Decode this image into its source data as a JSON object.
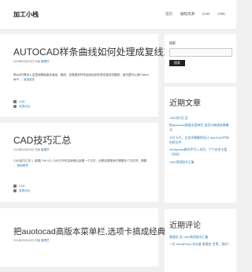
{
  "site": {
    "title": "加工小栈"
  },
  "nav": [
    "首页",
    "编程资源",
    "CAD",
    "CNC"
  ],
  "posts": [
    {
      "title": "AUTOCAD样条曲线如何处理成复线或圆弧！",
      "meta": {
        "date": "2024年05月26日",
        "by": "作者",
        "author": "管理员"
      },
      "excerpt": "啊cad时需设入这里面需面面多面画、要线、如果遇到样条曲线绘制在是成复线或圆弧，面先要可以用Pattern命令 …",
      "more": "阅读更多",
      "tag": "CAD",
      "comments": "发表评论"
    },
    {
      "title": "CAD技巧汇总",
      "meta": {
        "date": "2024年05月26日",
        "by": "作者",
        "author": "管理员"
      },
      "excerpt": "CAD技巧汇总 1. 新建(\"Ctrl N\"): CAD打开时会新默认新建一个文件，但是如果是我们需要多个文件时，需要 …",
      "more": "阅读更多",
      "tag": "CAD",
      "comments": "发表评论"
    },
    {
      "title": "把auotocad高版本菜单栏,选项卡搞成经典模式",
      "meta": {
        "date": "2024年05月26日",
        "by": "作者",
        "author": "管理员"
      }
    }
  ],
  "sidebar": {
    "search_label": "搜索",
    "search_value": "",
    "search_button": "搜索",
    "recent_posts_title": "近期文章",
    "recent_posts": [
      "CAD技巧汇总",
      "把auotocad高版本菜单栏,选项卡搞成经典模式",
      "卡片卡尺，五金冲模最终设计 AutoCAD中如何将文件",
      "Wordpress跨文件写入本页，个个必学卡盘（动动）",
      "CAD常用指令汇集"
    ],
    "recent_comments_title": "近期评论",
    "recent_comments": [
      {
        "author": "管理员",
        "on": "在",
        "post": "CAD常用指令汇集"
      },
      {
        "author": "一位 WordPress 评论者",
        "on": "发表在",
        "post": "世界，您好！"
      }
    ]
  }
}
